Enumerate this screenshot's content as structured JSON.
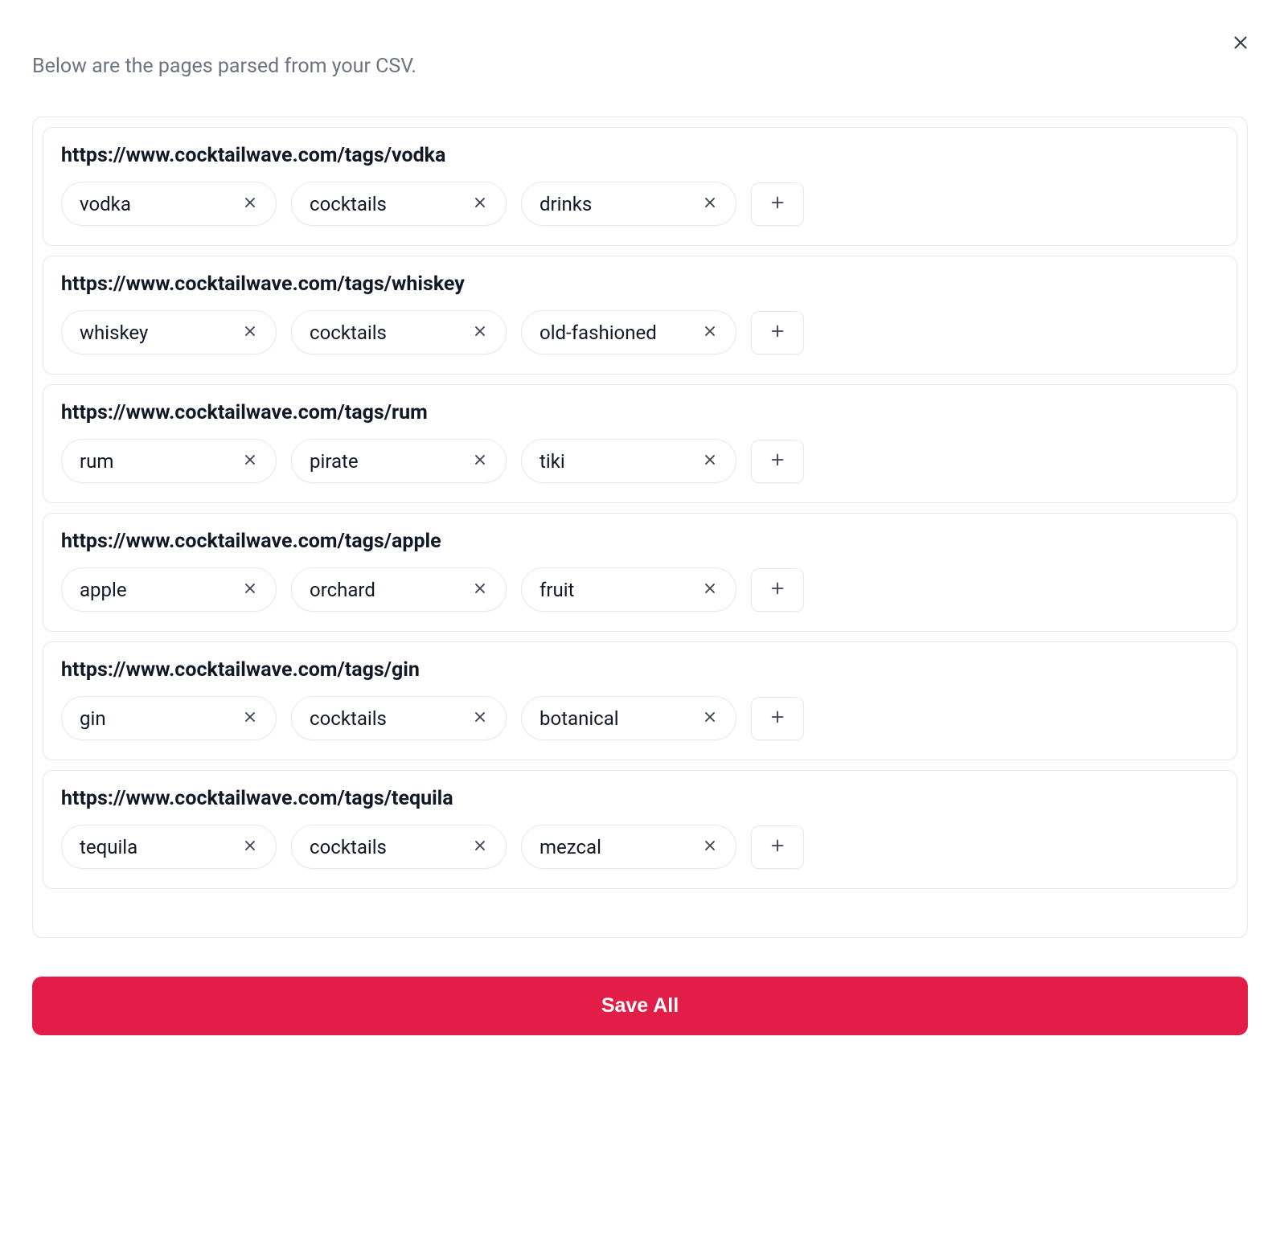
{
  "intro": "Below are the pages parsed from your CSV.",
  "saveAllLabel": "Save All",
  "pages": [
    {
      "url": "https://www.cocktailwave.com/tags/vodka",
      "tags": [
        "vodka",
        "cocktails",
        "drinks"
      ]
    },
    {
      "url": "https://www.cocktailwave.com/tags/whiskey",
      "tags": [
        "whiskey",
        "cocktails",
        "old-fashioned"
      ]
    },
    {
      "url": "https://www.cocktailwave.com/tags/rum",
      "tags": [
        "rum",
        "pirate",
        "tiki"
      ]
    },
    {
      "url": "https://www.cocktailwave.com/tags/apple",
      "tags": [
        "apple",
        "orchard",
        "fruit"
      ]
    },
    {
      "url": "https://www.cocktailwave.com/tags/gin",
      "tags": [
        "gin",
        "cocktails",
        "botanical"
      ]
    },
    {
      "url": "https://www.cocktailwave.com/tags/tequila",
      "tags": [
        "tequila",
        "cocktails",
        "mezcal"
      ]
    }
  ]
}
